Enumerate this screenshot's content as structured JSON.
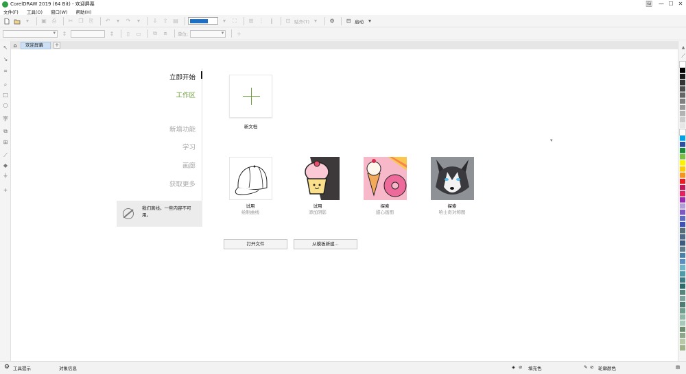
{
  "window": {
    "title": "CorelDRAW 2019 (64 Bit) - 欢迎屏幕",
    "controls": [
      "🖼",
      "—",
      "☐",
      "✕"
    ]
  },
  "menu": [
    "文件(F)",
    "工具(O)",
    "窗口(W)",
    "帮助(H)"
  ],
  "toolbar": {
    "zoom_value": "",
    "snap_label": "贴齐(T)",
    "launch_label": "启动",
    "quick_toolbar": ""
  },
  "propbar": {
    "units_label": "单位:"
  },
  "tabs": {
    "welcome_label": "欢迎屏幕",
    "add_label": "+"
  },
  "nav": {
    "items": [
      {
        "label": "立即开始"
      },
      {
        "label": "工作区"
      },
      {
        "label": "新增功能"
      },
      {
        "label": "学习"
      },
      {
        "label": "画廊"
      },
      {
        "label": "获取更多"
      }
    ]
  },
  "offline_notice": "我们离线。一些内容不可用。",
  "new_document": {
    "label": "新文档"
  },
  "templates": [
    {
      "title": "试用",
      "subtitle": "绘制曲线"
    },
    {
      "title": "试用",
      "subtitle": "添加阴影"
    },
    {
      "title": "探索",
      "subtitle": "甜心画图"
    },
    {
      "title": "探索",
      "subtitle": "哈士奇对称图"
    }
  ],
  "buttons": {
    "open_file": "打开文件",
    "from_template": "从模板新建..."
  },
  "status": {
    "tool_hint": "工具提示",
    "object_info": "对象信息",
    "fill_color": "填充色",
    "outline_color": "轮廓颜色"
  },
  "colors": {
    "accent_green": "#6a9e3a",
    "tab_blue": "#cde0f3"
  },
  "palette_colors": [
    "#ffffff",
    "#000000",
    "#1a1a1a",
    "#333333",
    "#4d4d4d",
    "#666666",
    "#808080",
    "#999999",
    "#b3b3b3",
    "#cccccc",
    "#e6e6e6",
    "#ffffff",
    "#00a2e8",
    "#2d4fa3",
    "#1b8a3a",
    "#7ac142",
    "#fff200",
    "#ffcc00",
    "#f7941d",
    "#ed1c24",
    "#c2185b",
    "#e91e63",
    "#9c27b0",
    "#b39ddb",
    "#7e57c2",
    "#5c6bc0",
    "#3f51b5",
    "#546e7a",
    "#4e6a8a",
    "#3d5a80",
    "#607d8b",
    "#4a7fa8",
    "#5a8fbf",
    "#6bb5c9",
    "#4f9aa8",
    "#3e7d86",
    "#2f6b6b",
    "#56857e",
    "#7ba39b",
    "#4c7c74",
    "#6f9e8d",
    "#8db8a7",
    "#a5c9b8",
    "#6d8e6e",
    "#8ca68a",
    "#b8c9a5",
    "#9fb38b"
  ]
}
